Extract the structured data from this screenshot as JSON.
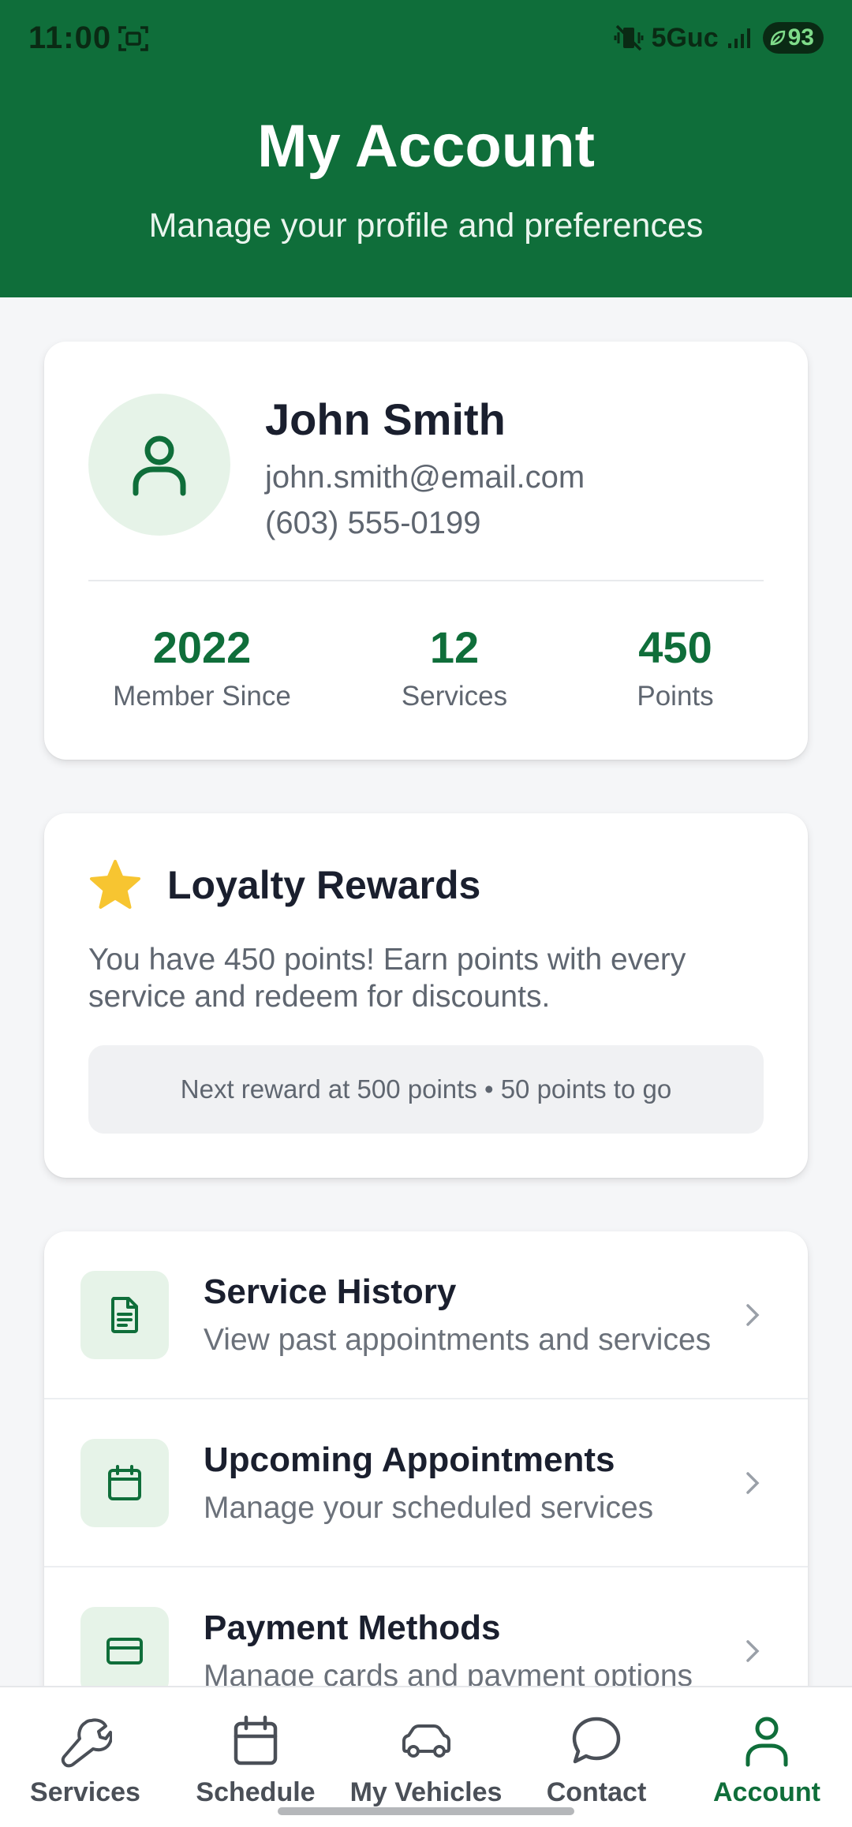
{
  "status_bar": {
    "time": "11:00",
    "network": "5Guc",
    "battery": "93"
  },
  "header": {
    "title": "My Account",
    "subtitle": "Manage your profile and preferences"
  },
  "profile": {
    "name": "John Smith",
    "email": "john.smith@email.com",
    "phone": "(603) 555-0199",
    "stats": [
      {
        "value": "2022",
        "label": "Member Since"
      },
      {
        "value": "12",
        "label": "Services"
      },
      {
        "value": "450",
        "label": "Points"
      }
    ]
  },
  "loyalty": {
    "title": "Loyalty Rewards",
    "description": "You have 450 points! Earn points with every service and redeem for discounts.",
    "next_reward": "Next reward at 500 points • 50 points to go"
  },
  "menu": [
    {
      "title": "Service History",
      "subtitle": "View past appointments and services",
      "icon": "document-icon"
    },
    {
      "title": "Upcoming Appointments",
      "subtitle": "Manage your scheduled services",
      "icon": "calendar-icon"
    },
    {
      "title": "Payment Methods",
      "subtitle": "Manage cards and payment options",
      "icon": "credit-card-icon"
    }
  ],
  "nav": [
    {
      "label": "Services",
      "icon": "wrench-icon",
      "active": false
    },
    {
      "label": "Schedule",
      "icon": "calendar-icon",
      "active": false
    },
    {
      "label": "My Vehicles",
      "icon": "car-icon",
      "active": false
    },
    {
      "label": "Contact",
      "icon": "chat-bubble-icon",
      "active": false
    },
    {
      "label": "Account",
      "icon": "person-icon",
      "active": true
    }
  ],
  "colors": {
    "brand_green": "#0f6e3a",
    "light_green": "#e6f3e8",
    "star_yellow": "#f7c531"
  }
}
